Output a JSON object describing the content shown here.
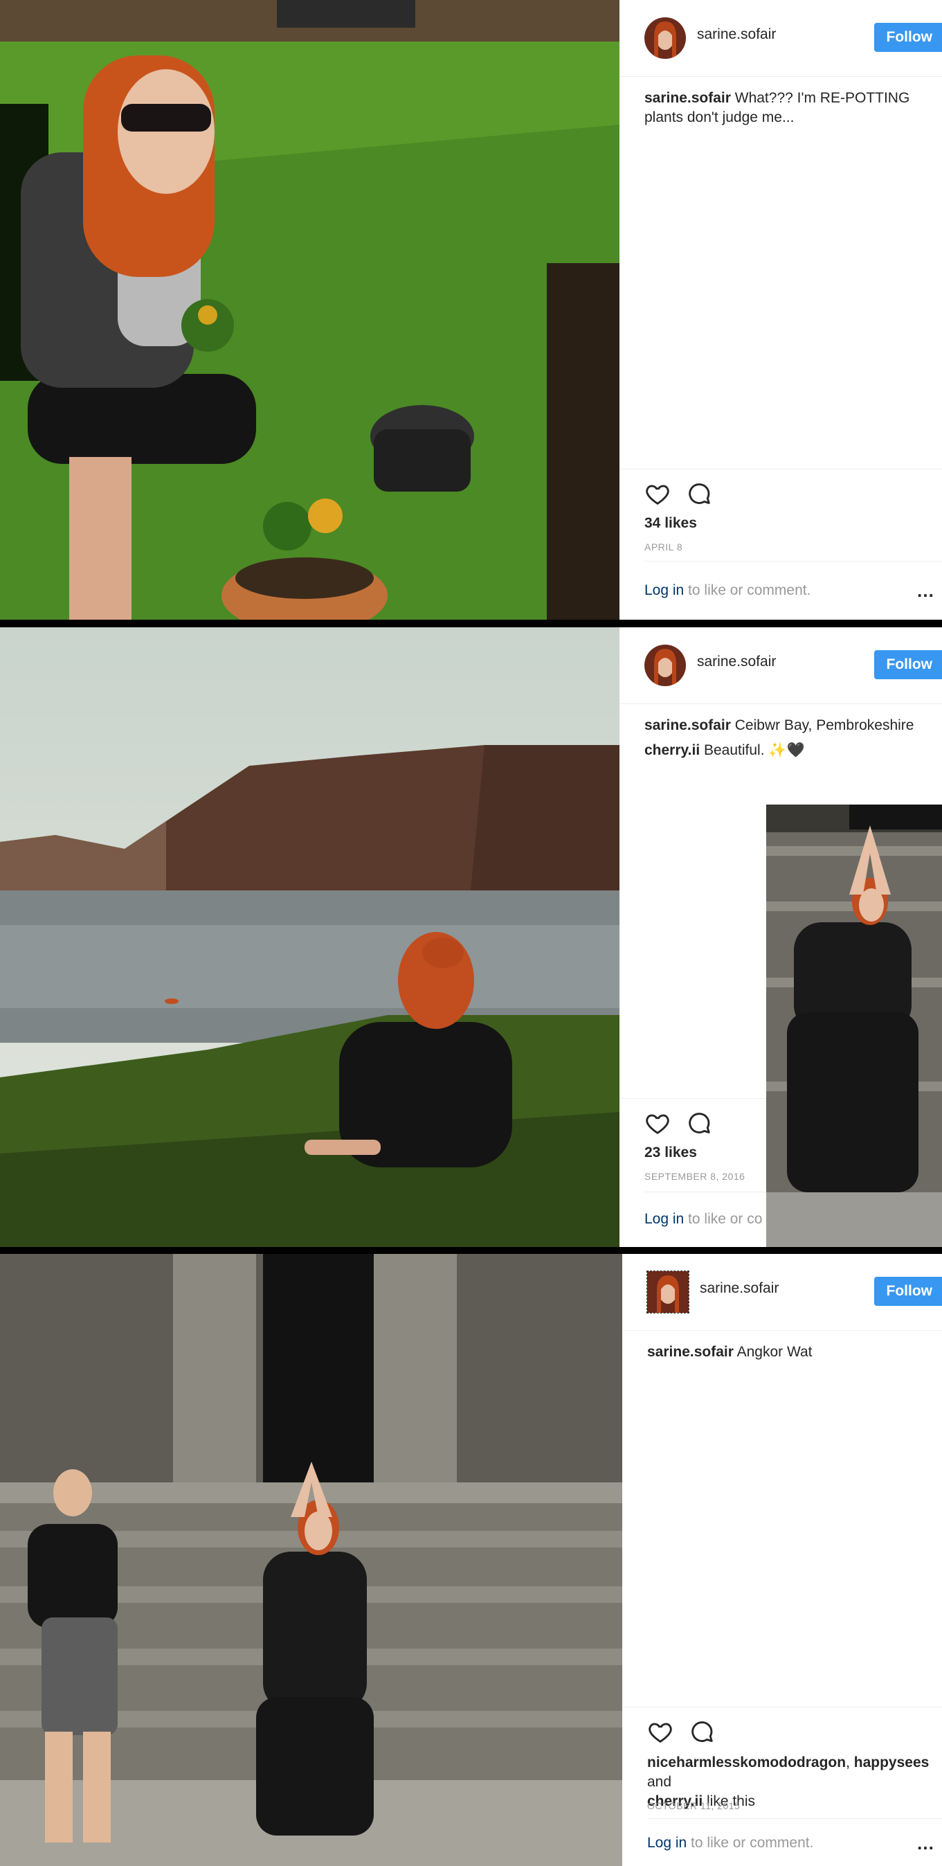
{
  "posts": [
    {
      "username": "sarine.sofair",
      "follow_label": "Follow",
      "caption_user": "sarine.sofair",
      "caption_text": "What??? I'm RE-POTTING plants don't judge me...",
      "likes": "34 likes",
      "date": "APRIL 8",
      "login_link": "Log in",
      "login_rest": " to like or comment.",
      "more": "…"
    },
    {
      "username": "sarine.sofair",
      "follow_label": "Follow",
      "caption_user": "sarine.sofair",
      "caption_text": "Ceibwr Bay, Pembrokeshire",
      "comment_user": "cherry.ii",
      "comment_text": "Beautiful. ✨🖤",
      "likes": "23 likes",
      "date": "SEPTEMBER 8, 2016",
      "login_link": "Log in",
      "login_rest": " to like or co"
    },
    {
      "username": "sarine.sofair",
      "follow_label": "Follow",
      "caption_user": "sarine.sofair",
      "caption_text": "Angkor Wat",
      "liked_by_1": "niceharmlesskomododragon",
      "liked_by_sep": ", ",
      "liked_by_2": "happysees",
      "liked_by_and": " and",
      "liked_by_3": "cherry.ii",
      "liked_by_tail": " like this",
      "date": "OCTOBER 11, 2015",
      "login_link": "Log in",
      "login_rest": " to like or comment.",
      "more": "…"
    }
  ],
  "icons": [
    "heart-icon",
    "comment-icon",
    "more-options-icon"
  ],
  "colors": {
    "follow_button": "#3897f0",
    "link": "#003569",
    "muted": "#999999",
    "divider": "#efefef"
  }
}
